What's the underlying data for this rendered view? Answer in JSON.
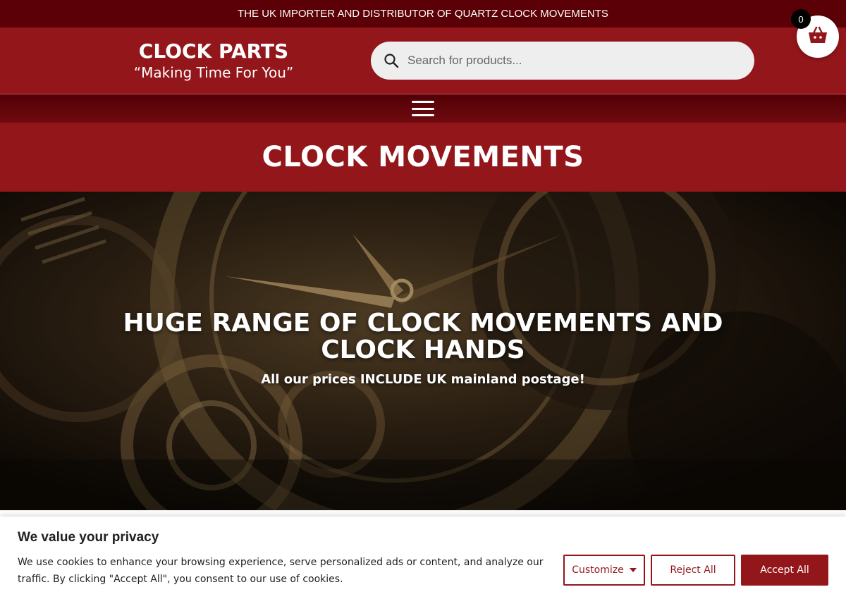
{
  "announcement": "THE UK IMPORTER AND DISTRIBUTOR OF QUARTZ CLOCK MOVEMENTS",
  "header": {
    "logo_name": "CLOCK PARTS",
    "logo_tagline": "“Making Time For You”",
    "search_placeholder": "Search for products...",
    "cart_count": "0"
  },
  "page_title": "CLOCK MOVEMENTS",
  "hero": {
    "headline": "HUGE RANGE OF CLOCK MOVEMENTS AND CLOCK HANDS",
    "subheadline": "All our prices INCLUDE UK mainland postage!"
  },
  "cookie_banner": {
    "title": "We value your privacy",
    "text": "We use cookies to enhance your browsing experience, serve personalized ads or content, and analyze our traffic. By clicking \"Accept All\", you consent to our use of cookies.",
    "customize_label": "Customize",
    "reject_label": "Reject All",
    "accept_label": "Accept All"
  },
  "icons": {
    "search": "search-icon",
    "cart": "basket-icon",
    "menu": "hamburger-menu-icon",
    "customize_caret": "caret-down-icon"
  },
  "colors": {
    "brand_red": "#93161b",
    "dark_red": "#5a0006",
    "white": "#ffffff"
  }
}
